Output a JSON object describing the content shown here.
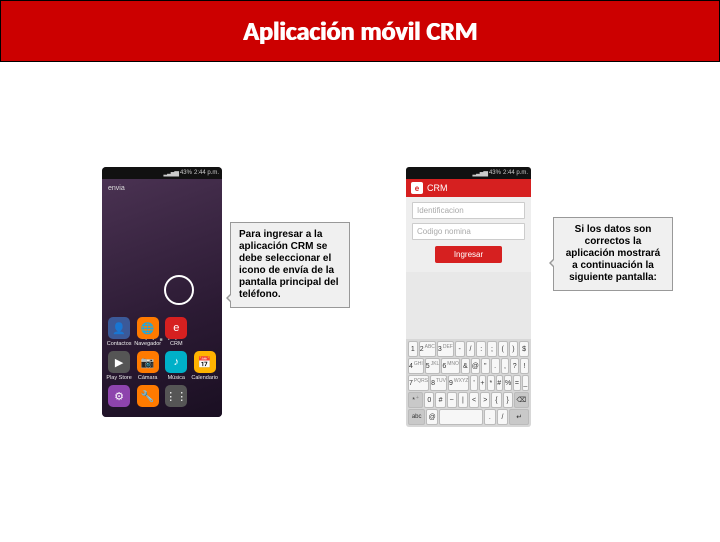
{
  "title": "Aplicación móvil CRM",
  "phone1": {
    "status": {
      "signal": "▂▃▅▆",
      "battery": "43%",
      "time": "2:44 p.m."
    },
    "brand": "envia",
    "dots": "• • ■ • •",
    "apps": [
      {
        "label": "Contactos",
        "cls": "i-blue",
        "glyph": "👤"
      },
      {
        "label": "Navegador",
        "cls": "i-orange",
        "glyph": "🌐"
      },
      {
        "label": "CRM",
        "cls": "i-red",
        "glyph": "e"
      },
      {
        "label": "",
        "cls": "",
        "glyph": ""
      },
      {
        "label": "Play Store",
        "cls": "i-gray",
        "glyph": "▶"
      },
      {
        "label": "Cámara",
        "cls": "i-orange",
        "glyph": "📷"
      },
      {
        "label": "Música",
        "cls": "i-teal",
        "glyph": "♪"
      },
      {
        "label": "Calendario",
        "cls": "i-yel",
        "glyph": "📅"
      },
      {
        "label": "",
        "cls": "i-purp",
        "glyph": "⚙"
      },
      {
        "label": "",
        "cls": "i-orange",
        "glyph": "🔧"
      },
      {
        "label": "",
        "cls": "i-gray",
        "glyph": "⋮⋮"
      },
      {
        "label": "",
        "cls": "",
        "glyph": ""
      }
    ]
  },
  "callout1": "Para ingresar a la aplicación CRM se debe seleccionar el icono de envía de la pantalla principal del teléfono.",
  "phone2": {
    "status": {
      "signal": "▂▃▅▆",
      "battery": "43%",
      "time": "2:44 p.m."
    },
    "app_title": "CRM",
    "field_id": "Identificacion",
    "field_code": "Codigo nomina",
    "login": "Ingresar",
    "keys": {
      "r1": [
        [
          "1",
          ""
        ],
        [
          "2",
          "ABC"
        ],
        [
          "3",
          "DEF"
        ],
        [
          "-",
          ""
        ],
        [
          "/",
          ""
        ],
        [
          ":",
          ""
        ],
        [
          ";",
          ""
        ],
        [
          "(",
          ""
        ],
        [
          ")",
          ""
        ],
        [
          "$",
          ""
        ]
      ],
      "r2": [
        [
          "4",
          "GHI"
        ],
        [
          "5",
          "JKL"
        ],
        [
          "6",
          "MNO"
        ],
        [
          "&",
          ""
        ],
        [
          "@",
          ""
        ],
        [
          "\"",
          ""
        ],
        [
          ".",
          ""
        ],
        [
          ",",
          ""
        ],
        [
          "?",
          ""
        ],
        [
          "!",
          ""
        ]
      ],
      "r3": [
        [
          "7",
          "PQRS"
        ],
        [
          "8",
          "TUV"
        ],
        [
          "9",
          "WXYZ"
        ],
        [
          "'",
          ""
        ],
        [
          "+",
          ""
        ],
        [
          "*",
          ""
        ],
        [
          "#",
          ""
        ],
        [
          "%",
          ""
        ],
        [
          "=",
          ""
        ],
        [
          "_",
          ""
        ]
      ],
      "r4": [
        [
          "*",
          "+"
        ],
        [
          "0",
          ""
        ],
        [
          "#",
          ""
        ],
        [
          "~",
          ""
        ],
        [
          "|",
          ""
        ],
        [
          "<",
          ""
        ],
        [
          ">",
          ""
        ],
        [
          "{",
          ""
        ],
        [
          "}",
          ""
        ],
        [
          "⌫",
          ""
        ]
      ],
      "r5": [
        "abc",
        "@",
        " ",
        ".",
        "/",
        "↵"
      ]
    }
  },
  "callout2": "Si los datos son correctos la aplicación mostrará a continuación la siguiente pantalla:"
}
